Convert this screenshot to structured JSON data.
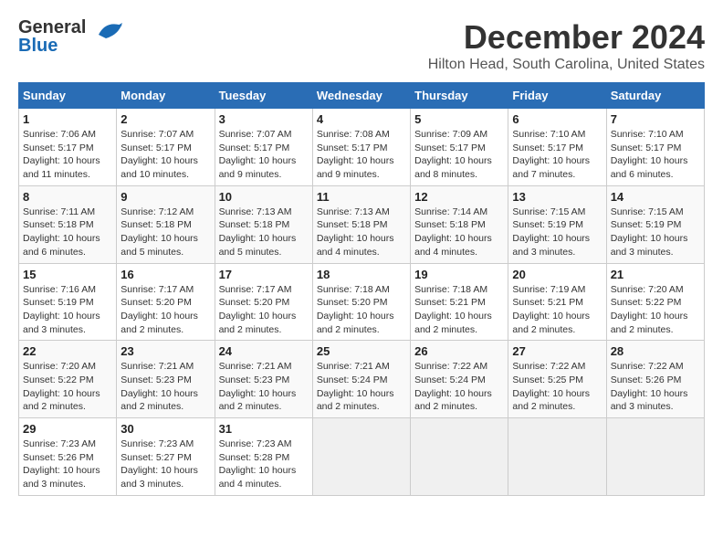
{
  "logo": {
    "line1": "General",
    "line2": "Blue"
  },
  "title": "December 2024",
  "location": "Hilton Head, South Carolina, United States",
  "days_of_week": [
    "Sunday",
    "Monday",
    "Tuesday",
    "Wednesday",
    "Thursday",
    "Friday",
    "Saturday"
  ],
  "weeks": [
    [
      {
        "day": "1",
        "sunrise": "7:06 AM",
        "sunset": "5:17 PM",
        "daylight": "10 hours and 11 minutes."
      },
      {
        "day": "2",
        "sunrise": "7:07 AM",
        "sunset": "5:17 PM",
        "daylight": "10 hours and 10 minutes."
      },
      {
        "day": "3",
        "sunrise": "7:07 AM",
        "sunset": "5:17 PM",
        "daylight": "10 hours and 9 minutes."
      },
      {
        "day": "4",
        "sunrise": "7:08 AM",
        "sunset": "5:17 PM",
        "daylight": "10 hours and 9 minutes."
      },
      {
        "day": "5",
        "sunrise": "7:09 AM",
        "sunset": "5:17 PM",
        "daylight": "10 hours and 8 minutes."
      },
      {
        "day": "6",
        "sunrise": "7:10 AM",
        "sunset": "5:17 PM",
        "daylight": "10 hours and 7 minutes."
      },
      {
        "day": "7",
        "sunrise": "7:10 AM",
        "sunset": "5:17 PM",
        "daylight": "10 hours and 6 minutes."
      }
    ],
    [
      {
        "day": "8",
        "sunrise": "7:11 AM",
        "sunset": "5:18 PM",
        "daylight": "10 hours and 6 minutes."
      },
      {
        "day": "9",
        "sunrise": "7:12 AM",
        "sunset": "5:18 PM",
        "daylight": "10 hours and 5 minutes."
      },
      {
        "day": "10",
        "sunrise": "7:13 AM",
        "sunset": "5:18 PM",
        "daylight": "10 hours and 5 minutes."
      },
      {
        "day": "11",
        "sunrise": "7:13 AM",
        "sunset": "5:18 PM",
        "daylight": "10 hours and 4 minutes."
      },
      {
        "day": "12",
        "sunrise": "7:14 AM",
        "sunset": "5:18 PM",
        "daylight": "10 hours and 4 minutes."
      },
      {
        "day": "13",
        "sunrise": "7:15 AM",
        "sunset": "5:19 PM",
        "daylight": "10 hours and 3 minutes."
      },
      {
        "day": "14",
        "sunrise": "7:15 AM",
        "sunset": "5:19 PM",
        "daylight": "10 hours and 3 minutes."
      }
    ],
    [
      {
        "day": "15",
        "sunrise": "7:16 AM",
        "sunset": "5:19 PM",
        "daylight": "10 hours and 3 minutes."
      },
      {
        "day": "16",
        "sunrise": "7:17 AM",
        "sunset": "5:20 PM",
        "daylight": "10 hours and 2 minutes."
      },
      {
        "day": "17",
        "sunrise": "7:17 AM",
        "sunset": "5:20 PM",
        "daylight": "10 hours and 2 minutes."
      },
      {
        "day": "18",
        "sunrise": "7:18 AM",
        "sunset": "5:20 PM",
        "daylight": "10 hours and 2 minutes."
      },
      {
        "day": "19",
        "sunrise": "7:18 AM",
        "sunset": "5:21 PM",
        "daylight": "10 hours and 2 minutes."
      },
      {
        "day": "20",
        "sunrise": "7:19 AM",
        "sunset": "5:21 PM",
        "daylight": "10 hours and 2 minutes."
      },
      {
        "day": "21",
        "sunrise": "7:20 AM",
        "sunset": "5:22 PM",
        "daylight": "10 hours and 2 minutes."
      }
    ],
    [
      {
        "day": "22",
        "sunrise": "7:20 AM",
        "sunset": "5:22 PM",
        "daylight": "10 hours and 2 minutes."
      },
      {
        "day": "23",
        "sunrise": "7:21 AM",
        "sunset": "5:23 PM",
        "daylight": "10 hours and 2 minutes."
      },
      {
        "day": "24",
        "sunrise": "7:21 AM",
        "sunset": "5:23 PM",
        "daylight": "10 hours and 2 minutes."
      },
      {
        "day": "25",
        "sunrise": "7:21 AM",
        "sunset": "5:24 PM",
        "daylight": "10 hours and 2 minutes."
      },
      {
        "day": "26",
        "sunrise": "7:22 AM",
        "sunset": "5:24 PM",
        "daylight": "10 hours and 2 minutes."
      },
      {
        "day": "27",
        "sunrise": "7:22 AM",
        "sunset": "5:25 PM",
        "daylight": "10 hours and 2 minutes."
      },
      {
        "day": "28",
        "sunrise": "7:22 AM",
        "sunset": "5:26 PM",
        "daylight": "10 hours and 3 minutes."
      }
    ],
    [
      {
        "day": "29",
        "sunrise": "7:23 AM",
        "sunset": "5:26 PM",
        "daylight": "10 hours and 3 minutes."
      },
      {
        "day": "30",
        "sunrise": "7:23 AM",
        "sunset": "5:27 PM",
        "daylight": "10 hours and 3 minutes."
      },
      {
        "day": "31",
        "sunrise": "7:23 AM",
        "sunset": "5:28 PM",
        "daylight": "10 hours and 4 minutes."
      },
      null,
      null,
      null,
      null
    ]
  ],
  "labels": {
    "sunrise": "Sunrise:",
    "sunset": "Sunset:",
    "daylight": "Daylight:"
  }
}
